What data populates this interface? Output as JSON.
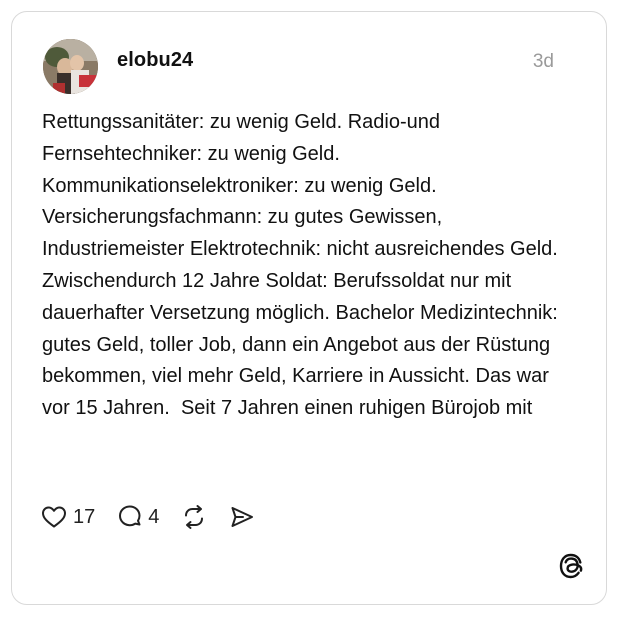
{
  "post": {
    "username": "elobu24",
    "timestamp": "3d",
    "text": "Rettungssanitäter: zu wenig Geld. Radio-und Fernsehtechniker: zu wenig Geld. Kommunikationselektroniker: zu wenig Geld. Versicherungsfachmann: zu gutes Gewissen, Industriemeister Elektrotechnik: nicht ausreichendes Geld. Zwischendurch 12 Jahre Soldat: Berufssoldat nur mit dauerhafter Versetzung möglich. Bachelor Medizintechnik: gutes Geld, toller Job, dann ein Angebot aus der Rüstung bekommen, viel mehr Geld, Karriere in Aussicht. Das war vor 15 Jahren.  Seit 7 Jahren einen ruhigen Bürojob mit"
  },
  "actions": {
    "like_count": "17",
    "reply_count": "4",
    "icons": [
      "heart-icon",
      "reply-icon",
      "repost-icon",
      "share-icon"
    ]
  },
  "branding": {
    "logo": "threads-logo-icon"
  }
}
